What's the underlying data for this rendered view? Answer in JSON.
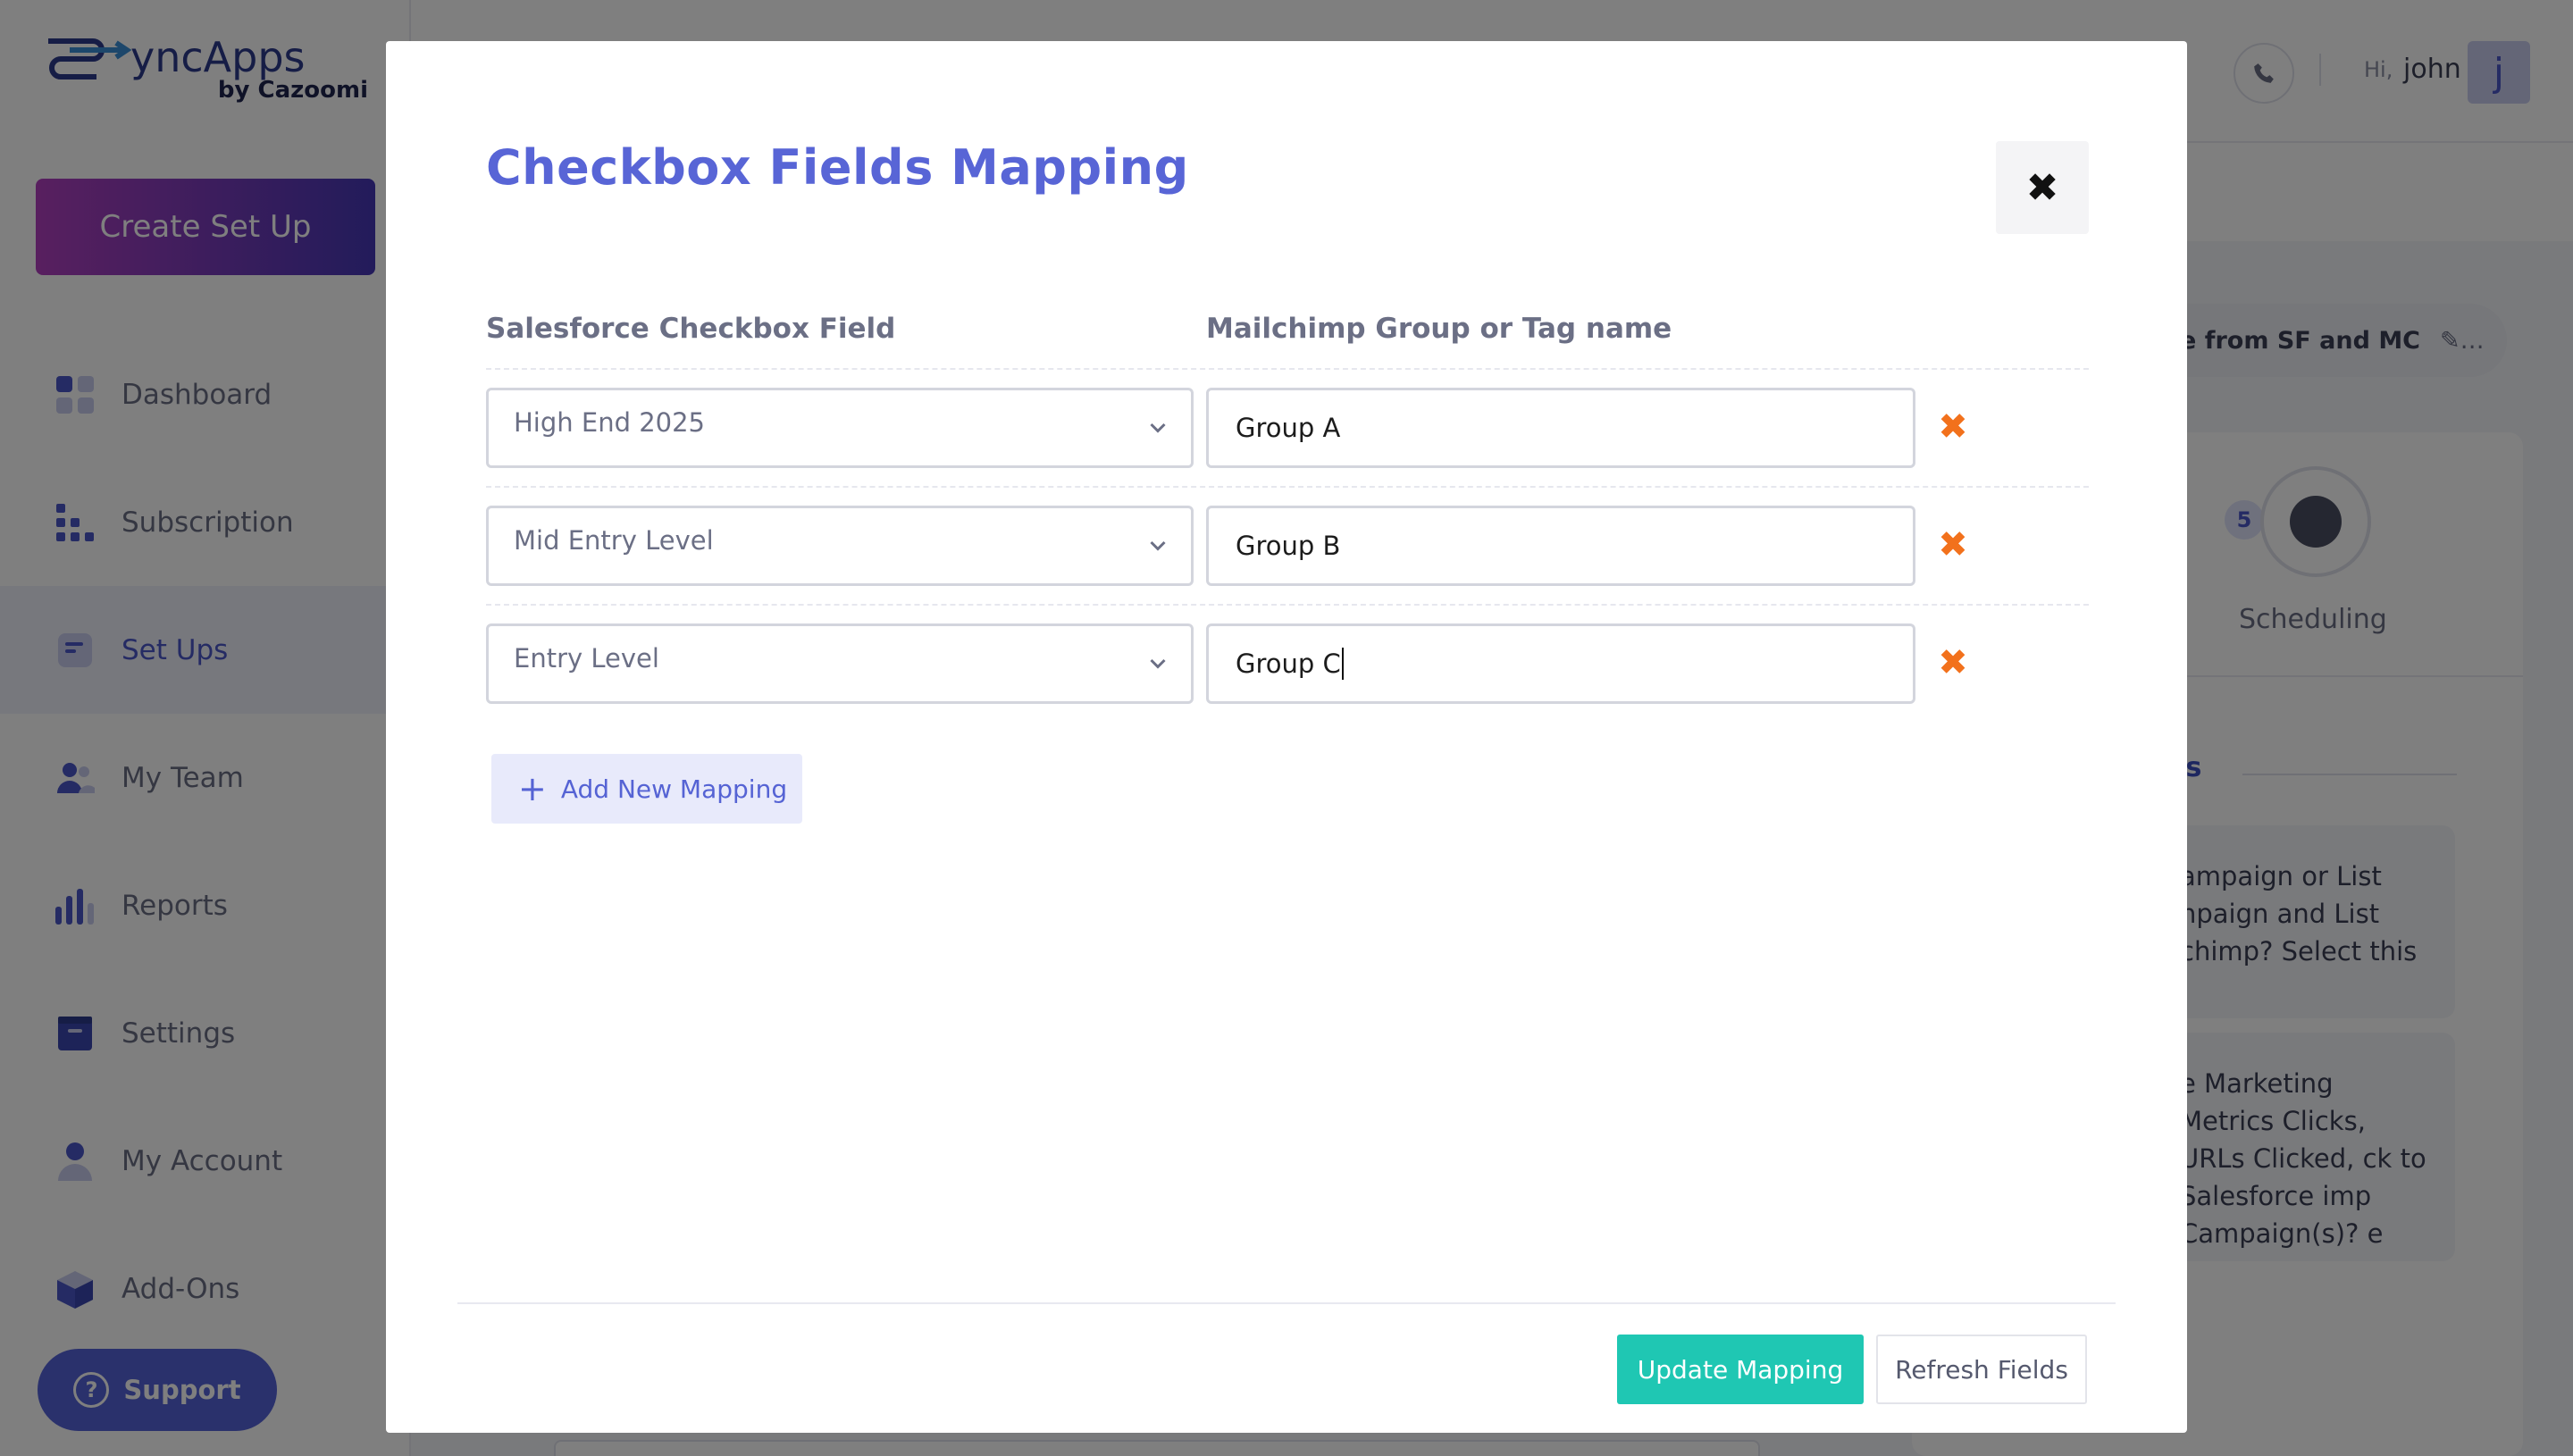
{
  "app": {
    "logo_text": "SyncApps",
    "logo_sub": "by Cazoomi",
    "create_button": "Create Set Up",
    "nav": [
      {
        "label": "Dashboard",
        "icon": "dashboard-icon"
      },
      {
        "label": "Subscription",
        "icon": "subscription-icon"
      },
      {
        "label": "Set Ups",
        "icon": "setups-icon",
        "active": true
      },
      {
        "label": "My Team",
        "icon": "team-icon"
      },
      {
        "label": "Reports",
        "icon": "reports-icon"
      },
      {
        "label": "Settings",
        "icon": "settings-icon"
      },
      {
        "label": "My Account",
        "icon": "account-icon"
      },
      {
        "label": "Add-Ons",
        "icon": "addons-icon"
      }
    ],
    "support_label": "Support",
    "topbar": {
      "hi": "Hi,",
      "user": "john",
      "avatar_letter": "j"
    },
    "pill_text": "e from SF and MC",
    "step": {
      "number": "5",
      "label": "Scheduling"
    },
    "features_title": "ures",
    "feature_1": "ampaign or List npaign and List chimp? Select this",
    "feature_2": "e Marketing Metrics Clicks, URLs Clicked, ck to Salesforce imp Campaign(s)? e"
  },
  "modal": {
    "title": "Checkbox Fields Mapping",
    "col_left": "Salesforce Checkbox Field",
    "col_right": "Mailchimp Group or Tag name",
    "rows": [
      {
        "sf_field": "High End 2025",
        "mc_value": "Group A"
      },
      {
        "sf_field": "Mid Entry Level",
        "mc_value": "Group B"
      },
      {
        "sf_field": "Entry Level",
        "mc_value": "Group C"
      }
    ],
    "add_label": "Add New Mapping",
    "update_label": "Update Mapping",
    "refresh_label": "Refresh Fields"
  },
  "colors": {
    "accent": "#5865d6",
    "update": "#1fc7b3",
    "delete": "#f2711c"
  }
}
